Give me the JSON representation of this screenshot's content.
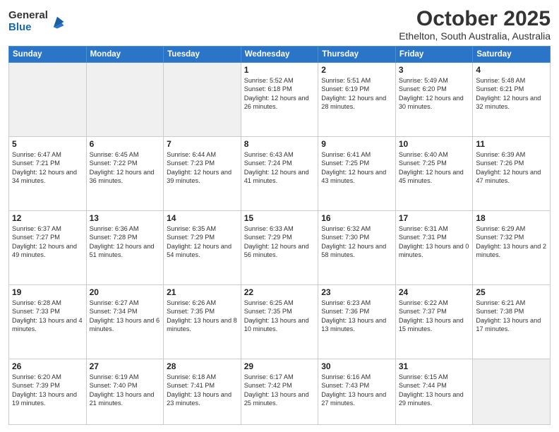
{
  "logo": {
    "general": "General",
    "blue": "Blue"
  },
  "header": {
    "month": "October 2025",
    "location": "Ethelton, South Australia, Australia"
  },
  "days_of_week": [
    "Sunday",
    "Monday",
    "Tuesday",
    "Wednesday",
    "Thursday",
    "Friday",
    "Saturday"
  ],
  "weeks": [
    [
      {
        "day": "",
        "info": ""
      },
      {
        "day": "",
        "info": ""
      },
      {
        "day": "",
        "info": ""
      },
      {
        "day": "1",
        "info": "Sunrise: 5:52 AM\nSunset: 6:18 PM\nDaylight: 12 hours\nand 26 minutes."
      },
      {
        "day": "2",
        "info": "Sunrise: 5:51 AM\nSunset: 6:19 PM\nDaylight: 12 hours\nand 28 minutes."
      },
      {
        "day": "3",
        "info": "Sunrise: 5:49 AM\nSunset: 6:20 PM\nDaylight: 12 hours\nand 30 minutes."
      },
      {
        "day": "4",
        "info": "Sunrise: 5:48 AM\nSunset: 6:21 PM\nDaylight: 12 hours\nand 32 minutes."
      }
    ],
    [
      {
        "day": "5",
        "info": "Sunrise: 6:47 AM\nSunset: 7:21 PM\nDaylight: 12 hours\nand 34 minutes."
      },
      {
        "day": "6",
        "info": "Sunrise: 6:45 AM\nSunset: 7:22 PM\nDaylight: 12 hours\nand 36 minutes."
      },
      {
        "day": "7",
        "info": "Sunrise: 6:44 AM\nSunset: 7:23 PM\nDaylight: 12 hours\nand 39 minutes."
      },
      {
        "day": "8",
        "info": "Sunrise: 6:43 AM\nSunset: 7:24 PM\nDaylight: 12 hours\nand 41 minutes."
      },
      {
        "day": "9",
        "info": "Sunrise: 6:41 AM\nSunset: 7:25 PM\nDaylight: 12 hours\nand 43 minutes."
      },
      {
        "day": "10",
        "info": "Sunrise: 6:40 AM\nSunset: 7:25 PM\nDaylight: 12 hours\nand 45 minutes."
      },
      {
        "day": "11",
        "info": "Sunrise: 6:39 AM\nSunset: 7:26 PM\nDaylight: 12 hours\nand 47 minutes."
      }
    ],
    [
      {
        "day": "12",
        "info": "Sunrise: 6:37 AM\nSunset: 7:27 PM\nDaylight: 12 hours\nand 49 minutes."
      },
      {
        "day": "13",
        "info": "Sunrise: 6:36 AM\nSunset: 7:28 PM\nDaylight: 12 hours\nand 51 minutes."
      },
      {
        "day": "14",
        "info": "Sunrise: 6:35 AM\nSunset: 7:29 PM\nDaylight: 12 hours\nand 54 minutes."
      },
      {
        "day": "15",
        "info": "Sunrise: 6:33 AM\nSunset: 7:29 PM\nDaylight: 12 hours\nand 56 minutes."
      },
      {
        "day": "16",
        "info": "Sunrise: 6:32 AM\nSunset: 7:30 PM\nDaylight: 12 hours\nand 58 minutes."
      },
      {
        "day": "17",
        "info": "Sunrise: 6:31 AM\nSunset: 7:31 PM\nDaylight: 13 hours\nand 0 minutes."
      },
      {
        "day": "18",
        "info": "Sunrise: 6:29 AM\nSunset: 7:32 PM\nDaylight: 13 hours\nand 2 minutes."
      }
    ],
    [
      {
        "day": "19",
        "info": "Sunrise: 6:28 AM\nSunset: 7:33 PM\nDaylight: 13 hours\nand 4 minutes."
      },
      {
        "day": "20",
        "info": "Sunrise: 6:27 AM\nSunset: 7:34 PM\nDaylight: 13 hours\nand 6 minutes."
      },
      {
        "day": "21",
        "info": "Sunrise: 6:26 AM\nSunset: 7:35 PM\nDaylight: 13 hours\nand 8 minutes."
      },
      {
        "day": "22",
        "info": "Sunrise: 6:25 AM\nSunset: 7:35 PM\nDaylight: 13 hours\nand 10 minutes."
      },
      {
        "day": "23",
        "info": "Sunrise: 6:23 AM\nSunset: 7:36 PM\nDaylight: 13 hours\nand 13 minutes."
      },
      {
        "day": "24",
        "info": "Sunrise: 6:22 AM\nSunset: 7:37 PM\nDaylight: 13 hours\nand 15 minutes."
      },
      {
        "day": "25",
        "info": "Sunrise: 6:21 AM\nSunset: 7:38 PM\nDaylight: 13 hours\nand 17 minutes."
      }
    ],
    [
      {
        "day": "26",
        "info": "Sunrise: 6:20 AM\nSunset: 7:39 PM\nDaylight: 13 hours\nand 19 minutes."
      },
      {
        "day": "27",
        "info": "Sunrise: 6:19 AM\nSunset: 7:40 PM\nDaylight: 13 hours\nand 21 minutes."
      },
      {
        "day": "28",
        "info": "Sunrise: 6:18 AM\nSunset: 7:41 PM\nDaylight: 13 hours\nand 23 minutes."
      },
      {
        "day": "29",
        "info": "Sunrise: 6:17 AM\nSunset: 7:42 PM\nDaylight: 13 hours\nand 25 minutes."
      },
      {
        "day": "30",
        "info": "Sunrise: 6:16 AM\nSunset: 7:43 PM\nDaylight: 13 hours\nand 27 minutes."
      },
      {
        "day": "31",
        "info": "Sunrise: 6:15 AM\nSunset: 7:44 PM\nDaylight: 13 hours\nand 29 minutes."
      },
      {
        "day": "",
        "info": ""
      }
    ]
  ]
}
